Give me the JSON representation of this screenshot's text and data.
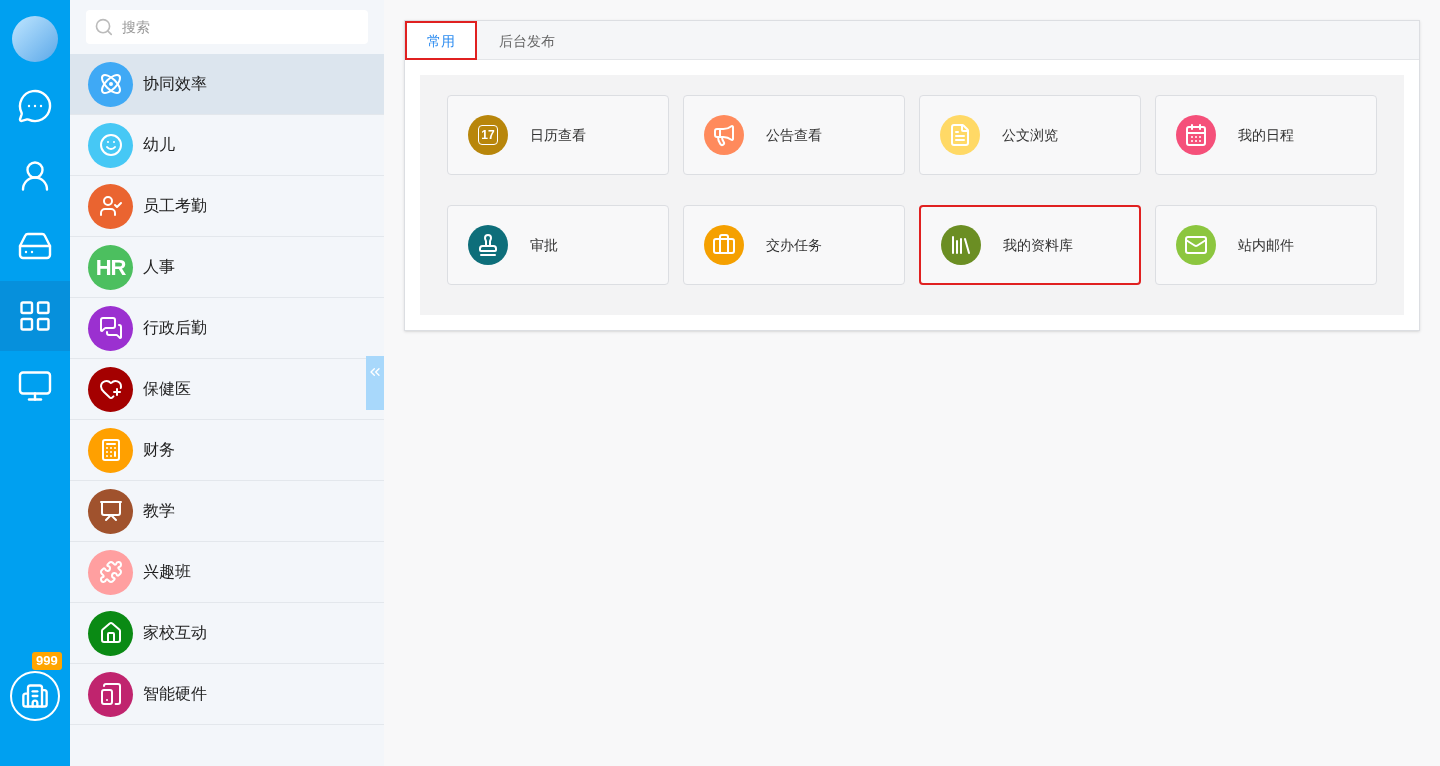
{
  "rail": {
    "nav": [
      {
        "selected": false
      },
      {
        "selected": false
      },
      {
        "selected": false
      },
      {
        "selected": true
      },
      {
        "selected": false
      }
    ],
    "badge": "999"
  },
  "sidebar": {
    "search": {
      "placeholder": "搜索"
    },
    "items": [
      {
        "label": "协同效率",
        "color": "#3fa9f5",
        "selected": true
      },
      {
        "label": "幼儿",
        "color": "#46c8f5",
        "selected": false
      },
      {
        "label": "员工考勤",
        "color": "#ea6430",
        "selected": false
      },
      {
        "label": "人事",
        "color": "#4cbf5f",
        "selected": false,
        "icon_text": "HR"
      },
      {
        "label": "行政后勤",
        "color": "#9b30d0",
        "selected": false
      },
      {
        "label": "保健医",
        "color": "#a40000",
        "selected": false
      },
      {
        "label": "财务",
        "color": "#ffa000",
        "selected": false
      },
      {
        "label": "教学",
        "color": "#a0522d",
        "selected": false
      },
      {
        "label": "兴趣班",
        "color": "#ff9fa0",
        "selected": false
      },
      {
        "label": "家校互动",
        "color": "#0a8a14",
        "selected": false
      },
      {
        "label": "智能硬件",
        "color": "#c0246e",
        "selected": false
      }
    ]
  },
  "tabs": [
    {
      "label": "常用",
      "selected": true,
      "highlighted": true
    },
    {
      "label": "后台发布",
      "selected": false,
      "highlighted": false
    }
  ],
  "tiles": [
    {
      "label": "日历查看",
      "color": "#b8860b",
      "highlighted": false,
      "icon_text": "17"
    },
    {
      "label": "公告查看",
      "color": "#ff8a5c",
      "highlighted": false
    },
    {
      "label": "公文浏览",
      "color": "#ffd966",
      "highlighted": false
    },
    {
      "label": "我的日程",
      "color": "#f5507a",
      "highlighted": false
    },
    {
      "label": "审批",
      "color": "#0e6e7a",
      "highlighted": false
    },
    {
      "label": "交办任务",
      "color": "#f5a000",
      "highlighted": false
    },
    {
      "label": "我的资料库",
      "color": "#6b8e23",
      "highlighted": true
    },
    {
      "label": "站内邮件",
      "color": "#8cc63f",
      "highlighted": false
    }
  ]
}
